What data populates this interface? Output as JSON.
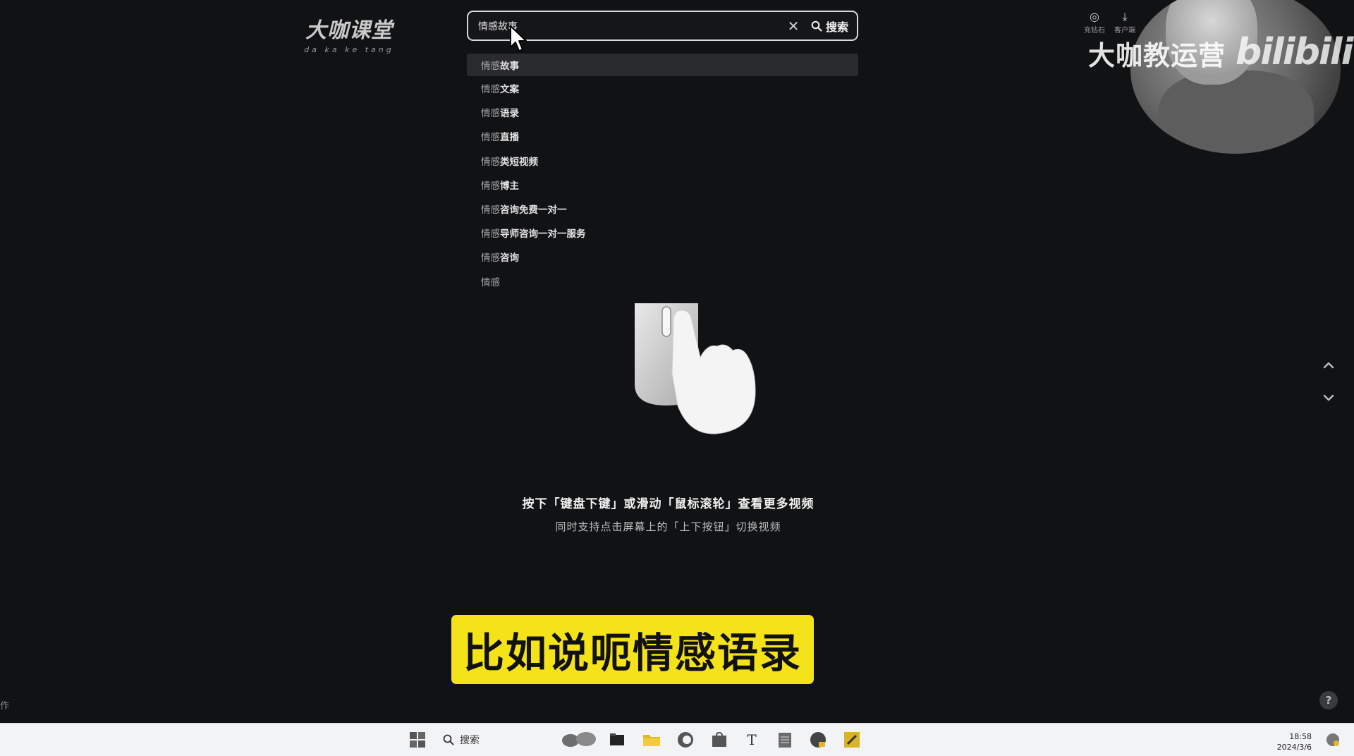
{
  "logo": {
    "main": "大咖课堂",
    "sub": "da ka ke tang"
  },
  "search": {
    "value": "情感故事",
    "clear_icon": "close-icon",
    "button_label": "搜索"
  },
  "suggestions": [
    {
      "prefix": "情感",
      "rest": "故事"
    },
    {
      "prefix": "情感",
      "rest": "文案"
    },
    {
      "prefix": "情感",
      "rest": "语录"
    },
    {
      "prefix": "情感",
      "rest": "直播"
    },
    {
      "prefix": "情感",
      "rest": "类短视频"
    },
    {
      "prefix": "情感",
      "rest": "博主"
    },
    {
      "prefix": "情感",
      "rest": "咨询免费一对一"
    },
    {
      "prefix": "情感",
      "rest": "导师咨询一对一服务"
    },
    {
      "prefix": "情感",
      "rest": "咨询"
    },
    {
      "prefix": "情感",
      "rest": ""
    }
  ],
  "hint": {
    "primary": "按下「键盘下键」或滑动「鼠标滚轮」查看更多视频",
    "secondary": "同时支持点击屏幕上的「上下按钮」切换视频"
  },
  "subtitle": "比如说呃情感语录",
  "top_right": {
    "recharge_label": "充钻石",
    "client_label": "客户端",
    "watermark": "大咖教运营",
    "bilibili": "bilibili"
  },
  "help_label": "?",
  "left_edge_text": "作",
  "taskbar": {
    "search_label": "搜索",
    "time": "18:58",
    "date": "2024/3/6"
  },
  "colors": {
    "background": "#111214",
    "subtitle_bg": "#f5e31a",
    "taskbar_bg": "#f2f3f5"
  }
}
